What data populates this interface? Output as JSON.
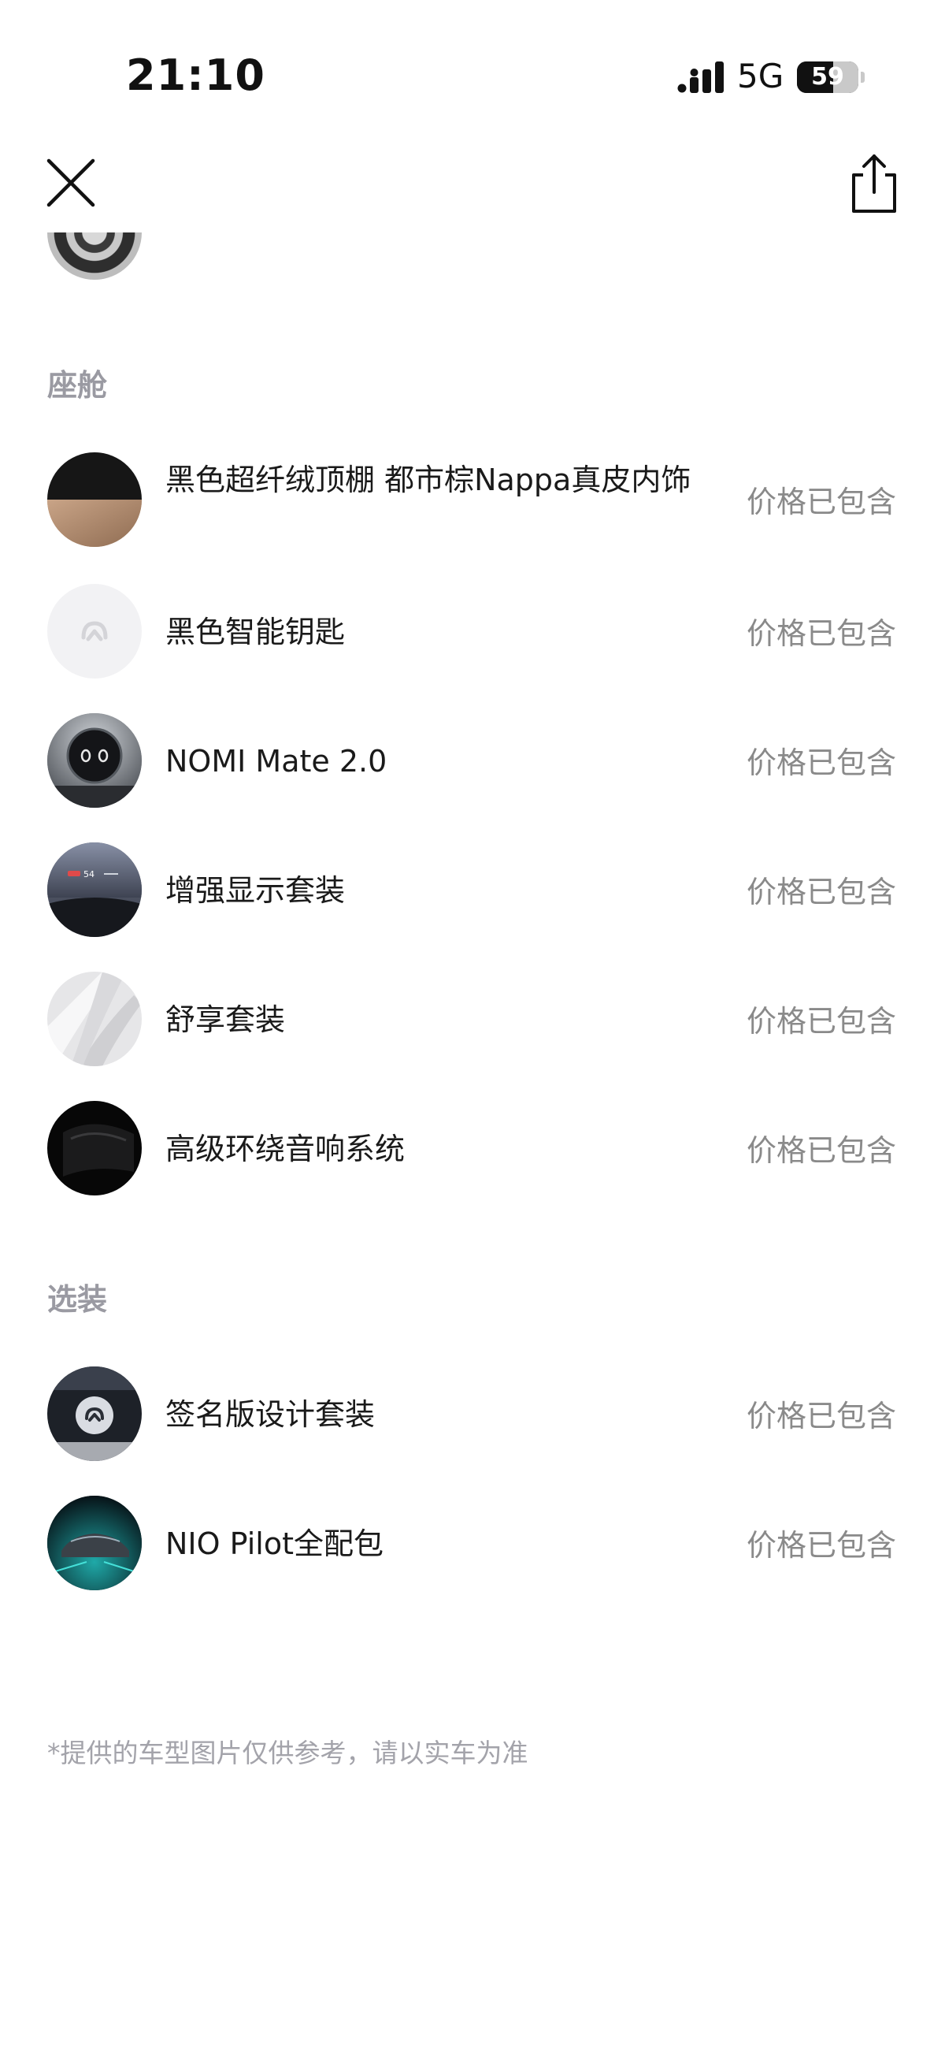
{
  "status_bar": {
    "time": "21:10",
    "network": "5G",
    "battery": "59",
    "battery_level_percent": 59
  },
  "toolbar": {
    "close_icon": "close-icon",
    "share_icon": "share-icon"
  },
  "partial_row": {
    "thumb_icon": "wheel-icon"
  },
  "sections": [
    {
      "title": "座舱",
      "items": [
        {
          "name": "黑色超纤绒顶棚 都市棕Nappa真皮内饰",
          "price": "价格已包含"
        },
        {
          "name": "黑色智能钥匙",
          "price": "价格已包含"
        },
        {
          "name": "NOMI Mate 2.0",
          "price": "价格已包含"
        },
        {
          "name": "增强显示套装",
          "price": "价格已包含"
        },
        {
          "name": "舒享套装",
          "price": "价格已包含"
        },
        {
          "name": "高级环绕音响系统",
          "price": "价格已包含"
        }
      ]
    },
    {
      "title": "选装",
      "items": [
        {
          "name": "签名版设计套装",
          "price": "价格已包含"
        },
        {
          "name": "NIO Pilot全配包",
          "price": "价格已包含"
        }
      ]
    }
  ],
  "hud_speed": "54",
  "footnote": "*提供的车型图片仅供参考，请以实车为准"
}
